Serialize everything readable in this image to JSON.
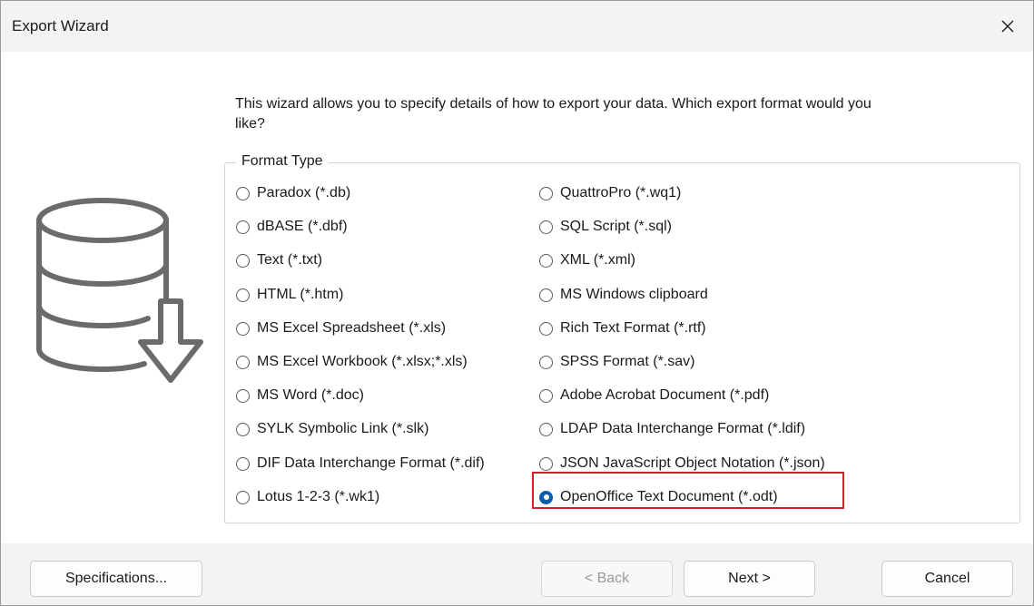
{
  "window": {
    "title": "Export Wizard",
    "close_icon": "close-icon"
  },
  "intro_text": "This wizard allows you to specify details of how to export your data. Which export format would you like?",
  "format_group": {
    "legend": "Format Type",
    "selected": "OpenOffice Text Document (*.odt)",
    "left_column": [
      "Paradox (*.db)",
      "dBASE (*.dbf)",
      "Text (*.txt)",
      "HTML (*.htm)",
      "MS Excel Spreadsheet (*.xls)",
      "MS Excel Workbook (*.xlsx;*.xls)",
      "MS Word (*.doc)",
      "SYLK Symbolic Link (*.slk)",
      "DIF Data Interchange Format (*.dif)",
      "Lotus 1-2-3 (*.wk1)"
    ],
    "right_column": [
      "QuattroPro (*.wq1)",
      "SQL Script (*.sql)",
      "XML (*.xml)",
      "MS Windows clipboard",
      "Rich Text Format (*.rtf)",
      "SPSS Format (*.sav)",
      "Adobe Acrobat Document (*.pdf)",
      "LDAP Data Interchange Format (*.ldif)",
      "JSON JavaScript Object Notation (*.json)",
      "OpenOffice Text Document (*.odt)"
    ]
  },
  "buttons": {
    "specifications": "Specifications...",
    "back": "< Back",
    "next": "Next >",
    "cancel": "Cancel"
  },
  "colors": {
    "selected_radio": "#0b5cad",
    "highlight_box": "#d0202a",
    "chrome": "#f3f3f3"
  },
  "icon": "database-export-icon"
}
